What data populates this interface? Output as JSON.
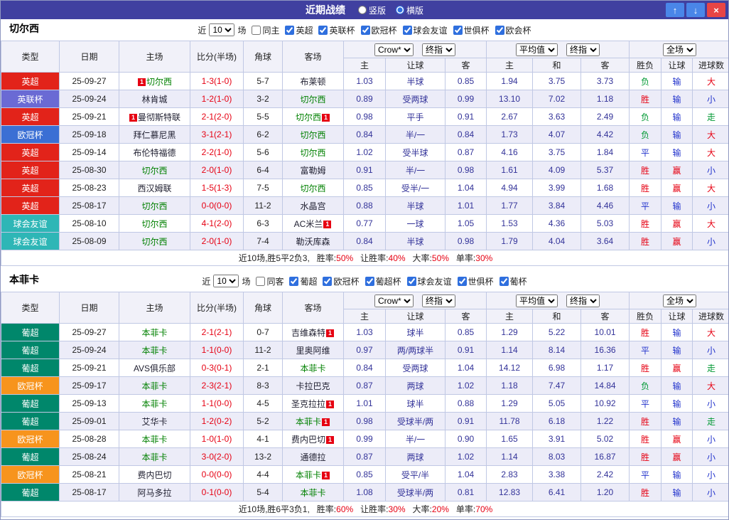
{
  "palette": {
    "red": "#e60012",
    "blue": "#2233cc",
    "green": "#009933",
    "focus_team": "#008000"
  },
  "topbar": {
    "title": "近期战绩",
    "radios": [
      {
        "label": "竖版",
        "selected": false
      },
      {
        "label": "横版",
        "selected": true
      }
    ],
    "up_button": "↑",
    "down_button": "↓",
    "close_button": "×"
  },
  "sections": [
    {
      "team": "切尔西",
      "filter": {
        "near": "近",
        "count": "10",
        "games": "场",
        "checkboxes": [
          {
            "label": "同主",
            "checked": false
          },
          {
            "label": "英超",
            "checked": true
          },
          {
            "label": "英联杯",
            "checked": true
          },
          {
            "label": "欧冠杯",
            "checked": true
          },
          {
            "label": "球会友谊",
            "checked": true
          },
          {
            "label": "世俱杯",
            "checked": true
          },
          {
            "label": "欧会杯",
            "checked": true
          }
        ]
      },
      "dropdowns": [
        "Crow*",
        "终指",
        "平均值",
        "终指",
        "全场"
      ],
      "columns": [
        "类型",
        "日期",
        "主场",
        "比分(半场)",
        "角球",
        "客场",
        "主",
        "让球",
        "客",
        "主",
        "和",
        "客",
        "胜负",
        "让球",
        "进球数"
      ],
      "rows": [
        {
          "league": "英超",
          "color": "#e2231a",
          "date": "25-09-27",
          "home": {
            "name": "切尔西",
            "focus": true,
            "badge": "1",
            "side": "left"
          },
          "score": "1-3(1-0)",
          "corners": "5-7",
          "away": {
            "name": "布莱顿"
          },
          "odds": [
            "1.03",
            "半球",
            "0.85"
          ],
          "avg": [
            "1.94",
            "3.75",
            "3.73"
          ],
          "outcome": [
            [
              "负",
              "green"
            ],
            [
              "输",
              "blue"
            ],
            [
              "大",
              "red"
            ]
          ]
        },
        {
          "league": "英联杯",
          "color": "#6a6ad4",
          "date": "25-09-24",
          "home": {
            "name": "林肯城"
          },
          "score": "1-2(1-0)",
          "corners": "3-2",
          "away": {
            "name": "切尔西",
            "focus": true
          },
          "odds": [
            "0.89",
            "受两球",
            "0.99"
          ],
          "avg": [
            "13.10",
            "7.02",
            "1.18"
          ],
          "outcome": [
            [
              "胜",
              "red"
            ],
            [
              "输",
              "blue"
            ],
            [
              "小",
              "blue"
            ]
          ]
        },
        {
          "league": "英超",
          "color": "#e2231a",
          "date": "25-09-21",
          "home": {
            "name": "曼彻斯特联",
            "badge": "1",
            "side": "left"
          },
          "score": "2-1(2-0)",
          "corners": "5-5",
          "away": {
            "name": "切尔西",
            "focus": true,
            "badge": "1",
            "side": "right"
          },
          "odds": [
            "0.98",
            "平手",
            "0.91"
          ],
          "avg": [
            "2.67",
            "3.63",
            "2.49"
          ],
          "outcome": [
            [
              "负",
              "green"
            ],
            [
              "输",
              "blue"
            ],
            [
              "走",
              "green"
            ]
          ]
        },
        {
          "league": "欧冠杯",
          "color": "#3b6fd4",
          "date": "25-09-18",
          "home": {
            "name": "拜仁慕尼黑"
          },
          "score": "3-1(2-1)",
          "corners": "6-2",
          "away": {
            "name": "切尔西",
            "focus": true
          },
          "odds": [
            "0.84",
            "半/一",
            "0.84"
          ],
          "avg": [
            "1.73",
            "4.07",
            "4.42"
          ],
          "outcome": [
            [
              "负",
              "green"
            ],
            [
              "输",
              "blue"
            ],
            [
              "大",
              "red"
            ]
          ]
        },
        {
          "league": "英超",
          "color": "#e2231a",
          "date": "25-09-14",
          "home": {
            "name": "布伦特福德"
          },
          "score": "2-2(1-0)",
          "corners": "5-6",
          "away": {
            "name": "切尔西",
            "focus": true
          },
          "odds": [
            "1.02",
            "受半球",
            "0.87"
          ],
          "avg": [
            "4.16",
            "3.75",
            "1.84"
          ],
          "outcome": [
            [
              "平",
              "blue"
            ],
            [
              "输",
              "blue"
            ],
            [
              "大",
              "red"
            ]
          ]
        },
        {
          "league": "英超",
          "color": "#e2231a",
          "date": "25-08-30",
          "home": {
            "name": "切尔西",
            "focus": true
          },
          "score": "2-0(1-0)",
          "corners": "6-4",
          "away": {
            "name": "富勒姆"
          },
          "odds": [
            "0.91",
            "半/一",
            "0.98"
          ],
          "avg": [
            "1.61",
            "4.09",
            "5.37"
          ],
          "outcome": [
            [
              "胜",
              "red"
            ],
            [
              "赢",
              "red"
            ],
            [
              "小",
              "blue"
            ]
          ]
        },
        {
          "league": "英超",
          "color": "#e2231a",
          "date": "25-08-23",
          "home": {
            "name": "西汉姆联"
          },
          "score": "1-5(1-3)",
          "corners": "7-5",
          "away": {
            "name": "切尔西",
            "focus": true
          },
          "odds": [
            "0.85",
            "受半/一",
            "1.04"
          ],
          "avg": [
            "4.94",
            "3.99",
            "1.68"
          ],
          "outcome": [
            [
              "胜",
              "red"
            ],
            [
              "赢",
              "red"
            ],
            [
              "大",
              "red"
            ]
          ]
        },
        {
          "league": "英超",
          "color": "#e2231a",
          "date": "25-08-17",
          "home": {
            "name": "切尔西",
            "focus": true
          },
          "score": "0-0(0-0)",
          "corners": "11-2",
          "away": {
            "name": "水晶宫"
          },
          "odds": [
            "0.88",
            "半球",
            "1.01"
          ],
          "avg": [
            "1.77",
            "3.84",
            "4.46"
          ],
          "outcome": [
            [
              "平",
              "blue"
            ],
            [
              "输",
              "blue"
            ],
            [
              "小",
              "blue"
            ]
          ]
        },
        {
          "league": "球会友谊",
          "color": "#2eb6b6",
          "date": "25-08-10",
          "home": {
            "name": "切尔西",
            "focus": true
          },
          "score": "4-1(2-0)",
          "corners": "6-3",
          "away": {
            "name": "AC米兰",
            "badge": "1",
            "side": "right"
          },
          "odds": [
            "0.77",
            "一球",
            "1.05"
          ],
          "avg": [
            "1.53",
            "4.36",
            "5.03"
          ],
          "outcome": [
            [
              "胜",
              "red"
            ],
            [
              "赢",
              "red"
            ],
            [
              "大",
              "red"
            ]
          ]
        },
        {
          "league": "球会友谊",
          "color": "#2eb6b6",
          "date": "25-08-09",
          "home": {
            "name": "切尔西",
            "focus": true
          },
          "score": "2-0(1-0)",
          "corners": "7-4",
          "away": {
            "name": "勒沃库森"
          },
          "odds": [
            "0.84",
            "半球",
            "0.98"
          ],
          "avg": [
            "1.79",
            "4.04",
            "3.64"
          ],
          "outcome": [
            [
              "胜",
              "red"
            ],
            [
              "赢",
              "red"
            ],
            [
              "小",
              "blue"
            ]
          ]
        }
      ],
      "summary": {
        "prefix": "近10场,胜5平2负3,",
        "stats": [
          {
            "label": "胜率:",
            "value": "50%"
          },
          {
            "label": "让胜率:",
            "value": "40%"
          },
          {
            "label": "大率:",
            "value": "50%"
          },
          {
            "label": "单率:",
            "value": "30%"
          }
        ]
      }
    },
    {
      "team": "本菲卡",
      "filter": {
        "near": "近",
        "count": "10",
        "games": "场",
        "checkboxes": [
          {
            "label": "同客",
            "checked": false
          },
          {
            "label": "葡超",
            "checked": true
          },
          {
            "label": "欧冠杯",
            "checked": true
          },
          {
            "label": "葡超杯",
            "checked": true
          },
          {
            "label": "球会友谊",
            "checked": true
          },
          {
            "label": "世俱杯",
            "checked": true
          },
          {
            "label": "葡杯",
            "checked": true
          }
        ]
      },
      "dropdowns": [
        "Crow*",
        "终指",
        "平均值",
        "终指",
        "全场"
      ],
      "columns": [
        "类型",
        "日期",
        "主场",
        "比分(半场)",
        "角球",
        "客场",
        "主",
        "让球",
        "客",
        "主",
        "和",
        "客",
        "胜负",
        "让球",
        "进球数"
      ],
      "rows": [
        {
          "league": "葡超",
          "color": "#00876b",
          "date": "25-09-27",
          "home": {
            "name": "本菲卡",
            "focus": true
          },
          "score": "2-1(2-1)",
          "corners": "0-7",
          "away": {
            "name": "吉维森特",
            "badge": "1",
            "side": "right"
          },
          "odds": [
            "1.03",
            "球半",
            "0.85"
          ],
          "avg": [
            "1.29",
            "5.22",
            "10.01"
          ],
          "outcome": [
            [
              "胜",
              "red"
            ],
            [
              "输",
              "blue"
            ],
            [
              "大",
              "red"
            ]
          ]
        },
        {
          "league": "葡超",
          "color": "#00876b",
          "date": "25-09-24",
          "home": {
            "name": "本菲卡",
            "focus": true
          },
          "score": "1-1(0-0)",
          "corners": "11-2",
          "away": {
            "name": "里奥阿维"
          },
          "odds": [
            "0.97",
            "两/两球半",
            "0.91"
          ],
          "avg": [
            "1.14",
            "8.14",
            "16.36"
          ],
          "outcome": [
            [
              "平",
              "blue"
            ],
            [
              "输",
              "blue"
            ],
            [
              "小",
              "blue"
            ]
          ]
        },
        {
          "league": "葡超",
          "color": "#00876b",
          "date": "25-09-21",
          "home": {
            "name": "AVS俱乐部"
          },
          "score": "0-3(0-1)",
          "corners": "2-1",
          "away": {
            "name": "本菲卡",
            "focus": true
          },
          "odds": [
            "0.84",
            "受两球",
            "1.04"
          ],
          "avg": [
            "14.12",
            "6.98",
            "1.17"
          ],
          "outcome": [
            [
              "胜",
              "red"
            ],
            [
              "赢",
              "red"
            ],
            [
              "走",
              "green"
            ]
          ]
        },
        {
          "league": "欧冠杯",
          "color": "#f7941d",
          "date": "25-09-17",
          "home": {
            "name": "本菲卡",
            "focus": true
          },
          "score": "2-3(2-1)",
          "corners": "8-3",
          "away": {
            "name": "卡拉巴克"
          },
          "odds": [
            "0.87",
            "两球",
            "1.02"
          ],
          "avg": [
            "1.18",
            "7.47",
            "14.84"
          ],
          "outcome": [
            [
              "负",
              "green"
            ],
            [
              "输",
              "blue"
            ],
            [
              "大",
              "red"
            ]
          ]
        },
        {
          "league": "葡超",
          "color": "#00876b",
          "date": "25-09-13",
          "home": {
            "name": "本菲卡",
            "focus": true
          },
          "score": "1-1(0-0)",
          "corners": "4-5",
          "away": {
            "name": "圣克拉拉",
            "badge": "1",
            "side": "right"
          },
          "odds": [
            "1.01",
            "球半",
            "0.88"
          ],
          "avg": [
            "1.29",
            "5.05",
            "10.92"
          ],
          "outcome": [
            [
              "平",
              "blue"
            ],
            [
              "输",
              "blue"
            ],
            [
              "小",
              "blue"
            ]
          ]
        },
        {
          "league": "葡超",
          "color": "#00876b",
          "date": "25-09-01",
          "home": {
            "name": "艾华卡"
          },
          "score": "1-2(0-2)",
          "corners": "5-2",
          "away": {
            "name": "本菲卡",
            "focus": true,
            "badge": "1",
            "side": "right"
          },
          "odds": [
            "0.98",
            "受球半/两",
            "0.91"
          ],
          "avg": [
            "11.78",
            "6.18",
            "1.22"
          ],
          "outcome": [
            [
              "胜",
              "red"
            ],
            [
              "输",
              "blue"
            ],
            [
              "走",
              "green"
            ]
          ]
        },
        {
          "league": "欧冠杯",
          "color": "#f7941d",
          "date": "25-08-28",
          "home": {
            "name": "本菲卡",
            "focus": true
          },
          "score": "1-0(1-0)",
          "corners": "4-1",
          "away": {
            "name": "费内巴切",
            "badge": "1",
            "side": "right"
          },
          "odds": [
            "0.99",
            "半/一",
            "0.90"
          ],
          "avg": [
            "1.65",
            "3.91",
            "5.02"
          ],
          "outcome": [
            [
              "胜",
              "red"
            ],
            [
              "赢",
              "red"
            ],
            [
              "小",
              "blue"
            ]
          ]
        },
        {
          "league": "葡超",
          "color": "#00876b",
          "date": "25-08-24",
          "home": {
            "name": "本菲卡",
            "focus": true
          },
          "score": "3-0(2-0)",
          "corners": "13-2",
          "away": {
            "name": "通德拉"
          },
          "odds": [
            "0.87",
            "两球",
            "1.02"
          ],
          "avg": [
            "1.14",
            "8.03",
            "16.87"
          ],
          "outcome": [
            [
              "胜",
              "red"
            ],
            [
              "赢",
              "red"
            ],
            [
              "小",
              "blue"
            ]
          ]
        },
        {
          "league": "欧冠杯",
          "color": "#f7941d",
          "date": "25-08-21",
          "home": {
            "name": "费内巴切"
          },
          "score": "0-0(0-0)",
          "corners": "4-4",
          "away": {
            "name": "本菲卡",
            "focus": true,
            "badge": "1",
            "side": "right"
          },
          "odds": [
            "0.85",
            "受平/半",
            "1.04"
          ],
          "avg": [
            "2.83",
            "3.38",
            "2.42"
          ],
          "outcome": [
            [
              "平",
              "blue"
            ],
            [
              "输",
              "blue"
            ],
            [
              "小",
              "blue"
            ]
          ]
        },
        {
          "league": "葡超",
          "color": "#00876b",
          "date": "25-08-17",
          "home": {
            "name": "阿马多拉"
          },
          "score": "0-1(0-0)",
          "corners": "5-4",
          "away": {
            "name": "本菲卡",
            "focus": true
          },
          "odds": [
            "1.08",
            "受球半/两",
            "0.81"
          ],
          "avg": [
            "12.83",
            "6.41",
            "1.20"
          ],
          "outcome": [
            [
              "胜",
              "red"
            ],
            [
              "输",
              "blue"
            ],
            [
              "小",
              "blue"
            ]
          ]
        }
      ],
      "summary": {
        "prefix": "近10场,胜6平3负1,",
        "stats": [
          {
            "label": "胜率:",
            "value": "60%"
          },
          {
            "label": "让胜率:",
            "value": "30%"
          },
          {
            "label": "大率:",
            "value": "20%"
          },
          {
            "label": "单率:",
            "value": "70%"
          }
        ]
      }
    }
  ]
}
